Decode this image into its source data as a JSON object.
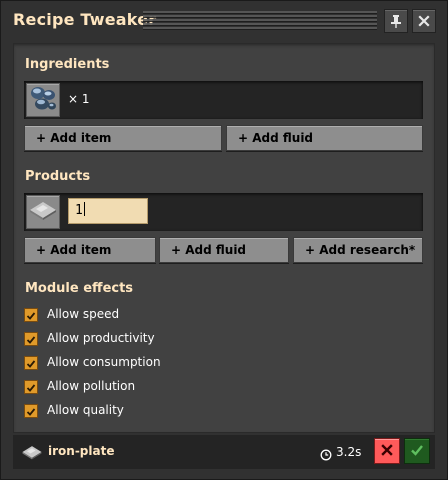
{
  "window": {
    "title": "Recipe Tweaker",
    "pin_icon": "pin-icon",
    "close_icon": "close-icon"
  },
  "ingredients": {
    "label": "Ingredients",
    "items": [
      {
        "icon": "iron-ore-icon",
        "amount": "× 1"
      }
    ],
    "add_item_label": "+ Add item",
    "add_fluid_label": "+ Add fluid"
  },
  "products": {
    "label": "Products",
    "items": [
      {
        "icon": "iron-plate-icon",
        "amount_value": "1"
      }
    ],
    "add_item_label": "+ Add item",
    "add_fluid_label": "+ Add fluid",
    "add_research_label": "+ Add research*"
  },
  "module_effects": {
    "label": "Module effects",
    "options": [
      {
        "label": "Allow speed",
        "checked": true
      },
      {
        "label": "Allow productivity",
        "checked": true
      },
      {
        "label": "Allow consumption",
        "checked": true
      },
      {
        "label": "Allow pollution",
        "checked": true
      },
      {
        "label": "Allow quality",
        "checked": true
      }
    ]
  },
  "footer": {
    "recipe_icon": "iron-plate-icon",
    "recipe_name": "iron-plate",
    "time_icon": "clock-icon",
    "time": "3.2s",
    "cancel_icon": "close-icon",
    "confirm_icon": "checkmark-icon"
  },
  "colors": {
    "heading": "#ffe6c0",
    "checkbox": "#e09a2a",
    "cancel_button": "#ff5a5a",
    "confirm_button": "#1f5a1f",
    "input_background": "#f1dcb2"
  }
}
